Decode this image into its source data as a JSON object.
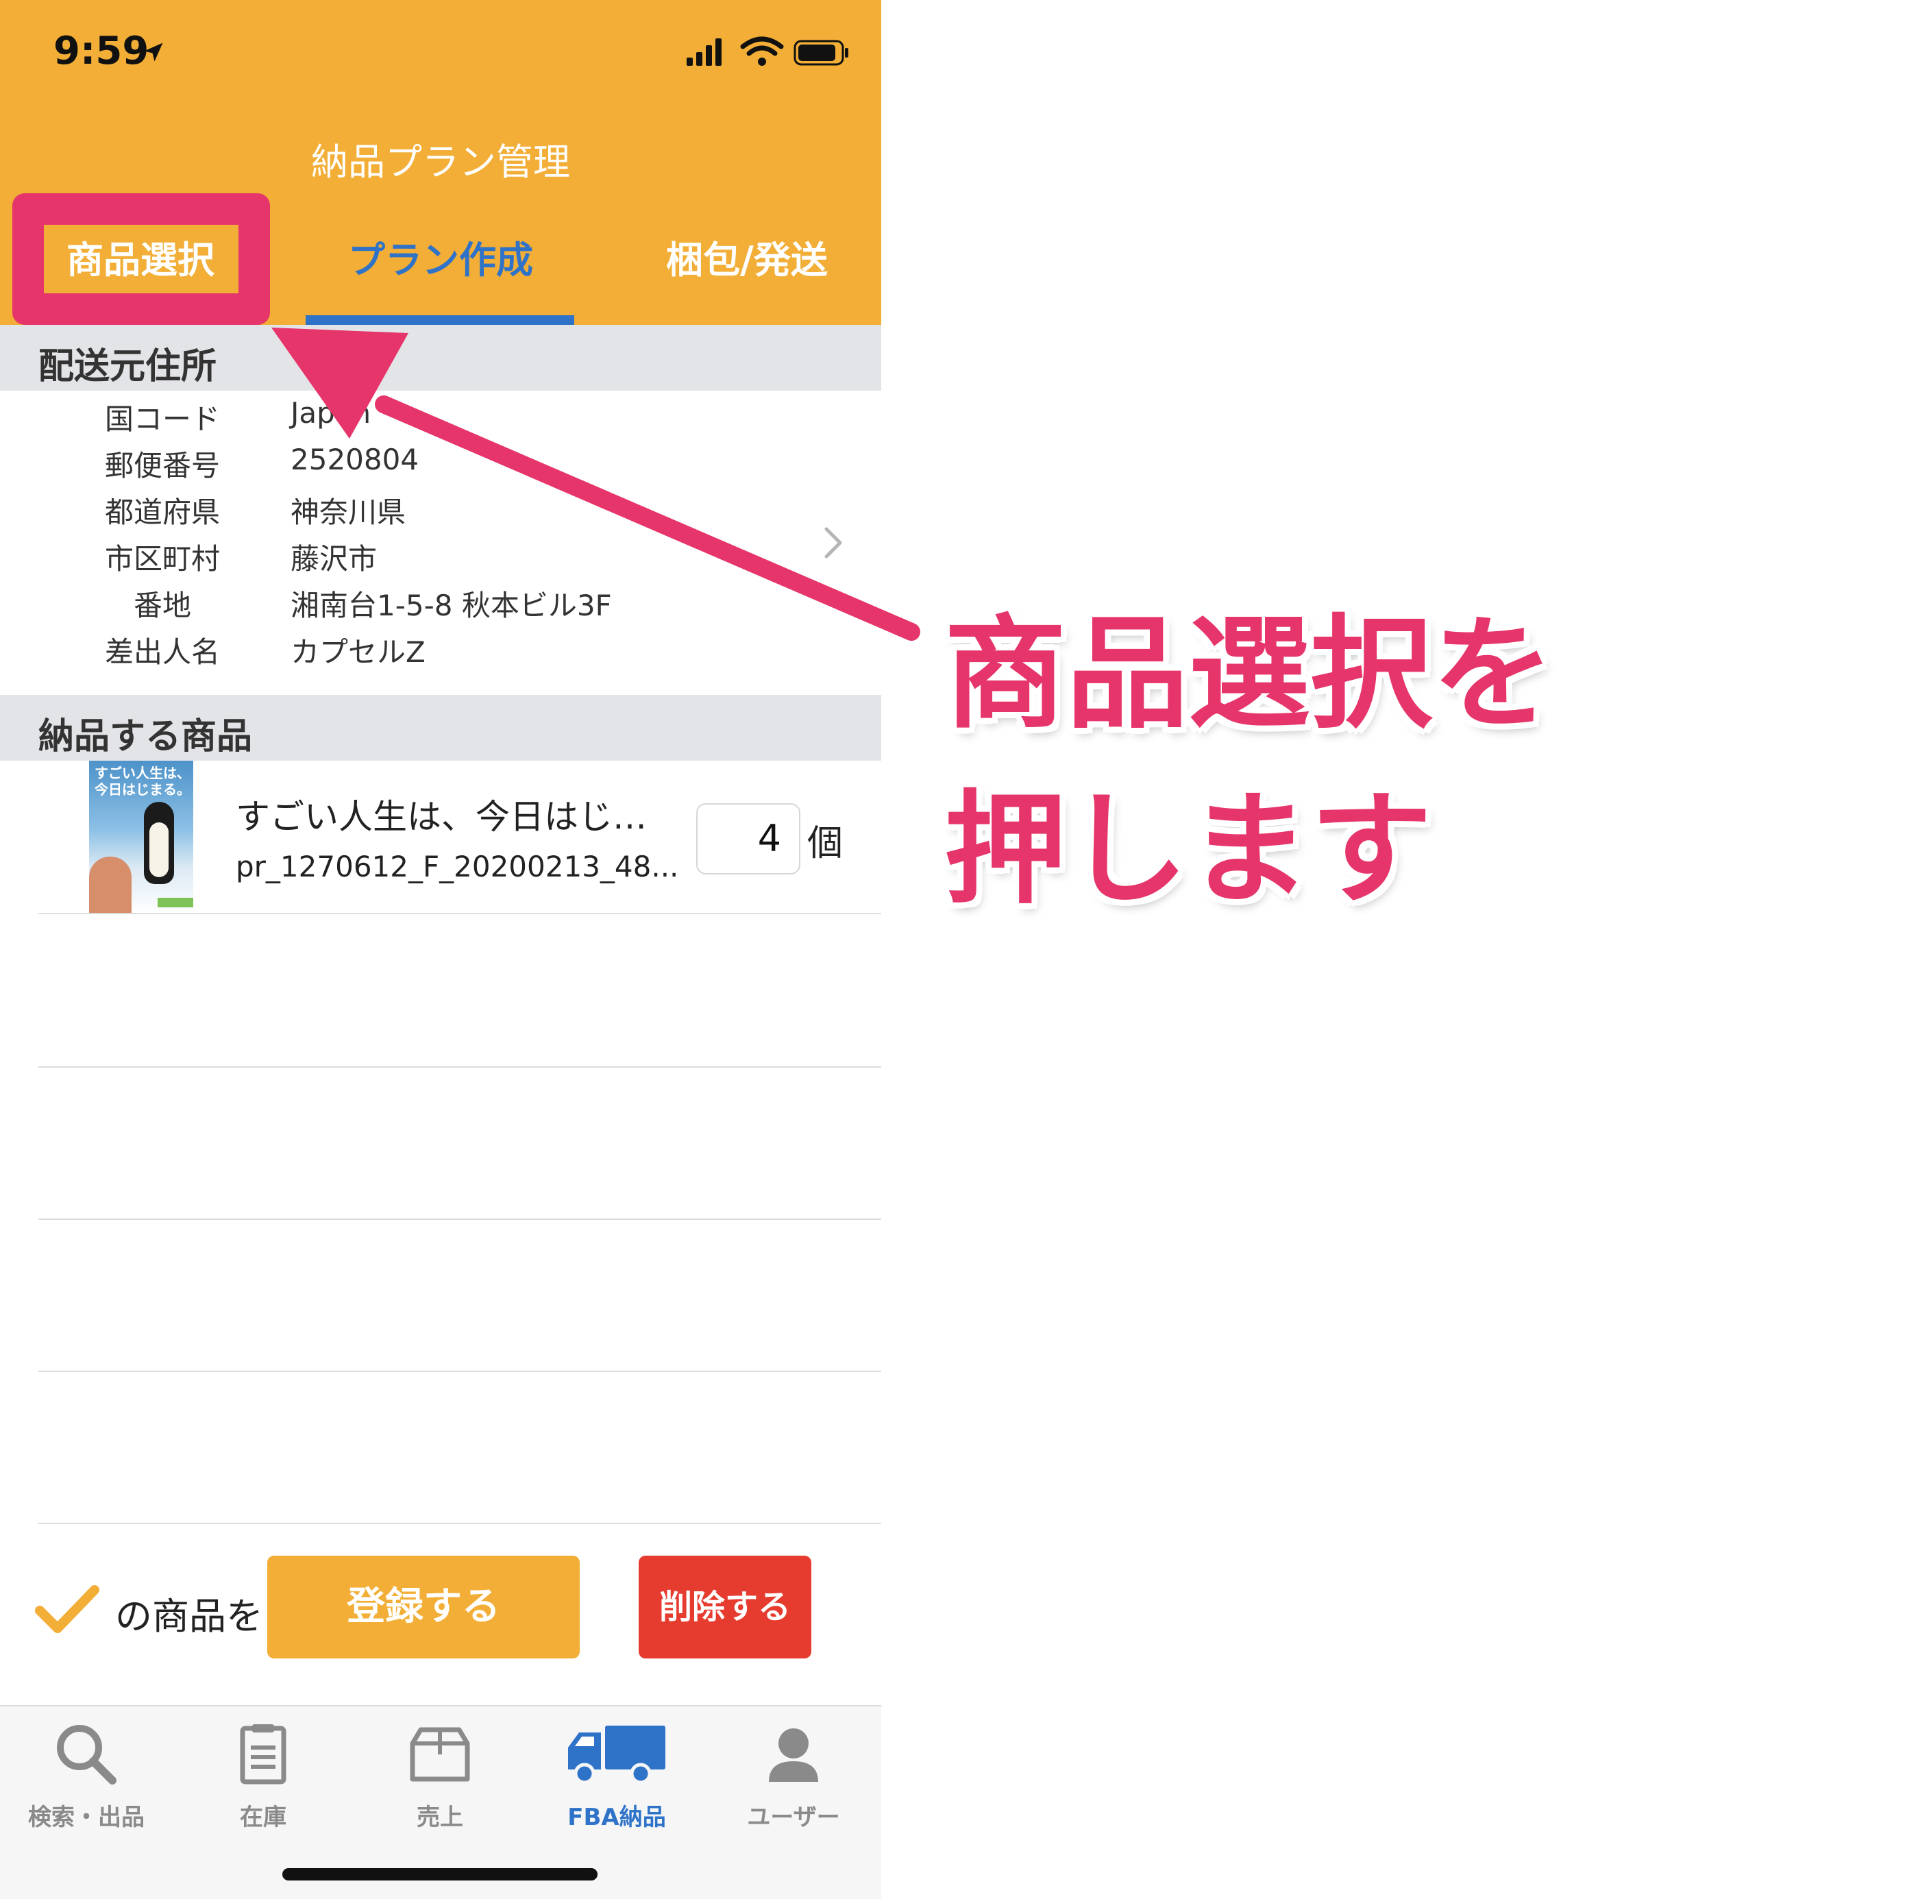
{
  "status_bar": {
    "time": "9:59"
  },
  "nav": {
    "title": "納品プラン管理"
  },
  "tabs": {
    "select": "商品選択",
    "plan": "プラン作成",
    "pack": "梱包/発送"
  },
  "address_section": {
    "header": "配送元住所",
    "rows": [
      {
        "label": "国コード",
        "value": "Japan"
      },
      {
        "label": "郵便番号",
        "value": "2520804"
      },
      {
        "label": "都道府県",
        "value": "神奈川県"
      },
      {
        "label": "市区町村",
        "value": "藤沢市"
      },
      {
        "label": "番地",
        "value": "湘南台1-5-8 秋本ビル3F"
      },
      {
        "label": "差出人名",
        "value": "カプセルZ"
      }
    ]
  },
  "items_section": {
    "header": "納品する商品",
    "items": [
      {
        "title": "すごい人生は、今日はじ…",
        "sku": "pr_1270612_F_20200213_48...",
        "quantity": "4",
        "unit": "個",
        "thumbnail_text": "すごい人生は、今日はじまる。"
      }
    ]
  },
  "bulk_actions": {
    "label": "の商品を",
    "register": "登録する",
    "delete": "削除する"
  },
  "tab_bar": [
    {
      "label": "検索・出品",
      "icon": "search-icon",
      "active": false
    },
    {
      "label": "在庫",
      "icon": "clipboard-icon",
      "active": false
    },
    {
      "label": "売上",
      "icon": "box-icon",
      "active": false
    },
    {
      "label": "FBA納品",
      "icon": "truck-icon",
      "active": true
    },
    {
      "label": "ユーザー",
      "icon": "user-icon",
      "active": false
    }
  ],
  "annotation": {
    "line1": "商品選択を",
    "line2": "押します"
  },
  "colors": {
    "header": "#f2ae36",
    "accent_blue": "#2f73c9",
    "annotation_pink": "#e6356a",
    "delete_red": "#e63c2f"
  }
}
